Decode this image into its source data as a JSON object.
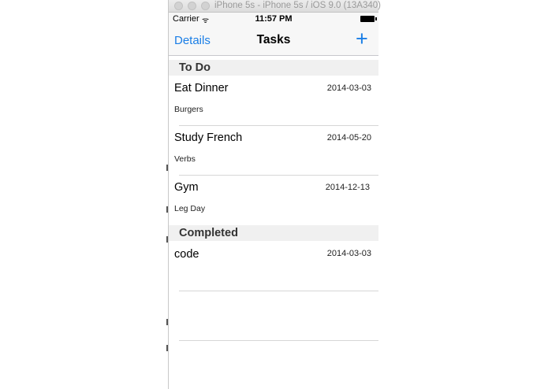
{
  "simulator": {
    "title": "iPhone 5s - iPhone 5s / iOS 9.0 (13A340)"
  },
  "status_bar": {
    "carrier": "Carrier",
    "wifi_glyph": "ᯤ",
    "time": "11:57 PM"
  },
  "nav": {
    "left_label": "Details",
    "title": "Tasks",
    "add_glyph": "+"
  },
  "sections": [
    {
      "header": "To Do",
      "rows": [
        {
          "title": "Eat Dinner",
          "date": "2014-03-03",
          "subtitle": "Burgers"
        },
        {
          "title": "Study French",
          "date": "2014-05-20",
          "subtitle": "Verbs"
        },
        {
          "title": "Gym",
          "date": "2014-12-13",
          "subtitle": "Leg Day"
        }
      ]
    },
    {
      "header": "Completed",
      "rows": [
        {
          "title": "code",
          "date": "2014-03-03",
          "subtitle": ""
        }
      ]
    }
  ],
  "colors": {
    "accent": "#1a7ee6",
    "section_bg": "#f0f0f0",
    "separator": "#d6d6d6"
  }
}
